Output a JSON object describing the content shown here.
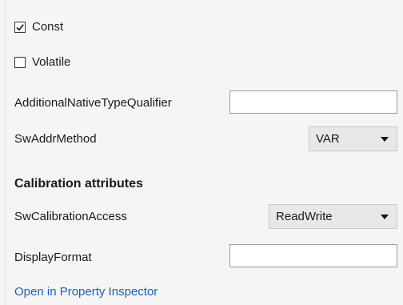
{
  "fields": {
    "const": {
      "label": "Const",
      "checked": true
    },
    "volatile": {
      "label": "Volatile",
      "checked": false
    },
    "additional_native_type_qualifier": {
      "label": "AdditionalNativeTypeQualifier",
      "value": ""
    },
    "sw_addr_method": {
      "label": "SwAddrMethod",
      "value": "VAR"
    }
  },
  "calibration": {
    "heading": "Calibration attributes",
    "sw_calibration_access": {
      "label": "SwCalibrationAccess",
      "value": "ReadWrite"
    },
    "display_format": {
      "label": "DisplayFormat",
      "value": ""
    }
  },
  "footer": {
    "link_label": "Open in Property Inspector"
  },
  "icons": {
    "checkbox_checked": "checkmark-icon",
    "dropdown": "chevron-down-icon"
  },
  "colors": {
    "link": "#1f5fb8",
    "background": "#f5f5f5"
  }
}
